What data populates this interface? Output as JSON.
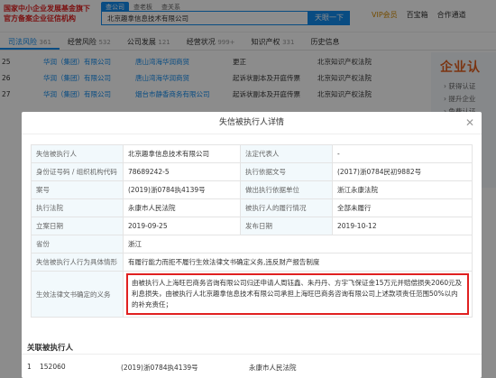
{
  "brand": {
    "line1": "国家中小企业发展基金旗下",
    "line2": "官方备案企业征信机构"
  },
  "search": {
    "tabs": [
      "查公司",
      "查老板",
      "查关系"
    ],
    "value": "北京趣拿信息技术有限公司",
    "button": "天眼一下"
  },
  "top_right": {
    "vip": "VIP会员",
    "item1": "百宝箱",
    "item2": "合作通道"
  },
  "nav": [
    {
      "label": "司法风险",
      "count": "361"
    },
    {
      "label": "经营风险",
      "count": "532"
    },
    {
      "label": "公司发展",
      "count": "121"
    },
    {
      "label": "经营状况",
      "count": "999+"
    },
    {
      "label": "知识产权",
      "count": "331"
    },
    {
      "label": "历史信息",
      "count": ""
    }
  ],
  "bg_rows": [
    {
      "num": "25",
      "company": "华润（集团）有限公司",
      "addr": "唐山湾海华润商贸",
      "type": "更正",
      "court": "北京知识产权法院"
    },
    {
      "num": "26",
      "company": "华润（集团）有限公司",
      "addr": "唐山湾海华润商贸",
      "type": "起诉状副本及开庭传票",
      "court": "北京知识产权法院"
    },
    {
      "num": "27",
      "company": "华润（集团）有限公司",
      "addr": "烟台市静香商务有限公司",
      "type": "起诉状副本及开庭传票",
      "court": "北京知识产权法院"
    }
  ],
  "ad": {
    "title": "企业认",
    "lines": [
      "› 获得认证",
      "› 提升企业",
      "› 免费认证"
    ]
  },
  "modal": {
    "title": "失信被执行人详情",
    "rows": [
      {
        "l1": "失信被执行人",
        "v1": "北京趣拿信息技术有限公司",
        "l2": "法定代表人",
        "v2": "-"
      },
      {
        "l1": "身份证号码 / 组织机构代码",
        "v1": "78689242-5",
        "l2": "执行依据文号",
        "v2": "(2017)浙0784民初9882号"
      },
      {
        "l1": "案号",
        "v1": "(2019)浙0784执4139号",
        "l2": "做出执行依据单位",
        "v2": "浙江永康法院"
      },
      {
        "l1": "执行法院",
        "v1": "永康市人民法院",
        "l2": "被执行人的履行情况",
        "v2": "全部未履行"
      },
      {
        "l1": "立案日期",
        "v1": "2019-09-25",
        "l2": "发布日期",
        "v2": "2019-10-12"
      }
    ],
    "province_label": "省份",
    "province": "浙江",
    "behavior_label": "失信被执行人行为具体情形",
    "behavior": "有履行能力而拒不履行生效法律文书确定义务,违反财产报告制度",
    "obligation_label": "生效法律文书确定的义务",
    "obligation": "由被执行人上海旺巴商务咨询有限公司归还申请人周钰鑫、朱丹丹、方宇飞保证金15万元并赔偿损失2060元及利息损失，由被执行人北京趣拿信息技术有限公司承担上海旺巴商务咨询有限公司上述款项责任范围50%以内的补充责任；",
    "related_title": "关联被执行人",
    "related_row": {
      "num": "1",
      "case": "152060",
      "no": "(2019)浙0784执4139号",
      "court": "永康市人民法院"
    }
  }
}
